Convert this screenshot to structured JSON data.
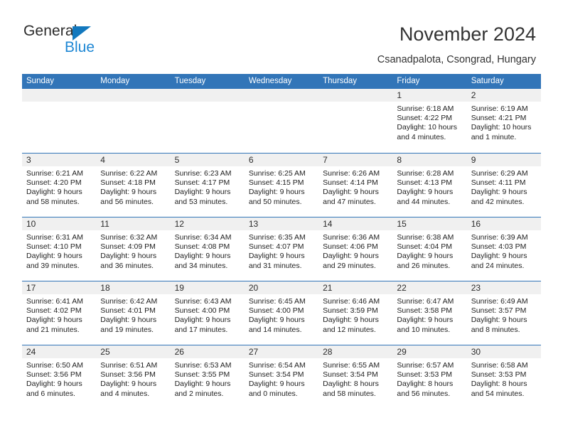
{
  "brand": {
    "name_part1": "General",
    "name_part2": "Blue",
    "triangle_color": "#1278be",
    "blue_text_color": "#1e87d4"
  },
  "header": {
    "title": "November 2024",
    "location": "Csanadpalota, Csongrad, Hungary"
  },
  "calendar": {
    "accent_color": "#3275b8",
    "day_band_color": "#f0f0f0",
    "weekdays": [
      "Sunday",
      "Monday",
      "Tuesday",
      "Wednesday",
      "Thursday",
      "Friday",
      "Saturday"
    ],
    "weeks": [
      [
        {
          "day": "",
          "empty": true
        },
        {
          "day": "",
          "empty": true
        },
        {
          "day": "",
          "empty": true
        },
        {
          "day": "",
          "empty": true
        },
        {
          "day": "",
          "empty": true
        },
        {
          "day": "1",
          "sunrise": "Sunrise: 6:18 AM",
          "sunset": "Sunset: 4:22 PM",
          "daylight1": "Daylight: 10 hours",
          "daylight2": "and 4 minutes."
        },
        {
          "day": "2",
          "sunrise": "Sunrise: 6:19 AM",
          "sunset": "Sunset: 4:21 PM",
          "daylight1": "Daylight: 10 hours",
          "daylight2": "and 1 minute."
        }
      ],
      [
        {
          "day": "3",
          "sunrise": "Sunrise: 6:21 AM",
          "sunset": "Sunset: 4:20 PM",
          "daylight1": "Daylight: 9 hours",
          "daylight2": "and 58 minutes."
        },
        {
          "day": "4",
          "sunrise": "Sunrise: 6:22 AM",
          "sunset": "Sunset: 4:18 PM",
          "daylight1": "Daylight: 9 hours",
          "daylight2": "and 56 minutes."
        },
        {
          "day": "5",
          "sunrise": "Sunrise: 6:23 AM",
          "sunset": "Sunset: 4:17 PM",
          "daylight1": "Daylight: 9 hours",
          "daylight2": "and 53 minutes."
        },
        {
          "day": "6",
          "sunrise": "Sunrise: 6:25 AM",
          "sunset": "Sunset: 4:15 PM",
          "daylight1": "Daylight: 9 hours",
          "daylight2": "and 50 minutes."
        },
        {
          "day": "7",
          "sunrise": "Sunrise: 6:26 AM",
          "sunset": "Sunset: 4:14 PM",
          "daylight1": "Daylight: 9 hours",
          "daylight2": "and 47 minutes."
        },
        {
          "day": "8",
          "sunrise": "Sunrise: 6:28 AM",
          "sunset": "Sunset: 4:13 PM",
          "daylight1": "Daylight: 9 hours",
          "daylight2": "and 44 minutes."
        },
        {
          "day": "9",
          "sunrise": "Sunrise: 6:29 AM",
          "sunset": "Sunset: 4:11 PM",
          "daylight1": "Daylight: 9 hours",
          "daylight2": "and 42 minutes."
        }
      ],
      [
        {
          "day": "10",
          "sunrise": "Sunrise: 6:31 AM",
          "sunset": "Sunset: 4:10 PM",
          "daylight1": "Daylight: 9 hours",
          "daylight2": "and 39 minutes."
        },
        {
          "day": "11",
          "sunrise": "Sunrise: 6:32 AM",
          "sunset": "Sunset: 4:09 PM",
          "daylight1": "Daylight: 9 hours",
          "daylight2": "and 36 minutes."
        },
        {
          "day": "12",
          "sunrise": "Sunrise: 6:34 AM",
          "sunset": "Sunset: 4:08 PM",
          "daylight1": "Daylight: 9 hours",
          "daylight2": "and 34 minutes."
        },
        {
          "day": "13",
          "sunrise": "Sunrise: 6:35 AM",
          "sunset": "Sunset: 4:07 PM",
          "daylight1": "Daylight: 9 hours",
          "daylight2": "and 31 minutes."
        },
        {
          "day": "14",
          "sunrise": "Sunrise: 6:36 AM",
          "sunset": "Sunset: 4:06 PM",
          "daylight1": "Daylight: 9 hours",
          "daylight2": "and 29 minutes."
        },
        {
          "day": "15",
          "sunrise": "Sunrise: 6:38 AM",
          "sunset": "Sunset: 4:04 PM",
          "daylight1": "Daylight: 9 hours",
          "daylight2": "and 26 minutes."
        },
        {
          "day": "16",
          "sunrise": "Sunrise: 6:39 AM",
          "sunset": "Sunset: 4:03 PM",
          "daylight1": "Daylight: 9 hours",
          "daylight2": "and 24 minutes."
        }
      ],
      [
        {
          "day": "17",
          "sunrise": "Sunrise: 6:41 AM",
          "sunset": "Sunset: 4:02 PM",
          "daylight1": "Daylight: 9 hours",
          "daylight2": "and 21 minutes."
        },
        {
          "day": "18",
          "sunrise": "Sunrise: 6:42 AM",
          "sunset": "Sunset: 4:01 PM",
          "daylight1": "Daylight: 9 hours",
          "daylight2": "and 19 minutes."
        },
        {
          "day": "19",
          "sunrise": "Sunrise: 6:43 AM",
          "sunset": "Sunset: 4:00 PM",
          "daylight1": "Daylight: 9 hours",
          "daylight2": "and 17 minutes."
        },
        {
          "day": "20",
          "sunrise": "Sunrise: 6:45 AM",
          "sunset": "Sunset: 4:00 PM",
          "daylight1": "Daylight: 9 hours",
          "daylight2": "and 14 minutes."
        },
        {
          "day": "21",
          "sunrise": "Sunrise: 6:46 AM",
          "sunset": "Sunset: 3:59 PM",
          "daylight1": "Daylight: 9 hours",
          "daylight2": "and 12 minutes."
        },
        {
          "day": "22",
          "sunrise": "Sunrise: 6:47 AM",
          "sunset": "Sunset: 3:58 PM",
          "daylight1": "Daylight: 9 hours",
          "daylight2": "and 10 minutes."
        },
        {
          "day": "23",
          "sunrise": "Sunrise: 6:49 AM",
          "sunset": "Sunset: 3:57 PM",
          "daylight1": "Daylight: 9 hours",
          "daylight2": "and 8 minutes."
        }
      ],
      [
        {
          "day": "24",
          "sunrise": "Sunrise: 6:50 AM",
          "sunset": "Sunset: 3:56 PM",
          "daylight1": "Daylight: 9 hours",
          "daylight2": "and 6 minutes."
        },
        {
          "day": "25",
          "sunrise": "Sunrise: 6:51 AM",
          "sunset": "Sunset: 3:56 PM",
          "daylight1": "Daylight: 9 hours",
          "daylight2": "and 4 minutes."
        },
        {
          "day": "26",
          "sunrise": "Sunrise: 6:53 AM",
          "sunset": "Sunset: 3:55 PM",
          "daylight1": "Daylight: 9 hours",
          "daylight2": "and 2 minutes."
        },
        {
          "day": "27",
          "sunrise": "Sunrise: 6:54 AM",
          "sunset": "Sunset: 3:54 PM",
          "daylight1": "Daylight: 9 hours",
          "daylight2": "and 0 minutes."
        },
        {
          "day": "28",
          "sunrise": "Sunrise: 6:55 AM",
          "sunset": "Sunset: 3:54 PM",
          "daylight1": "Daylight: 8 hours",
          "daylight2": "and 58 minutes."
        },
        {
          "day": "29",
          "sunrise": "Sunrise: 6:57 AM",
          "sunset": "Sunset: 3:53 PM",
          "daylight1": "Daylight: 8 hours",
          "daylight2": "and 56 minutes."
        },
        {
          "day": "30",
          "sunrise": "Sunrise: 6:58 AM",
          "sunset": "Sunset: 3:53 PM",
          "daylight1": "Daylight: 8 hours",
          "daylight2": "and 54 minutes."
        }
      ]
    ]
  }
}
